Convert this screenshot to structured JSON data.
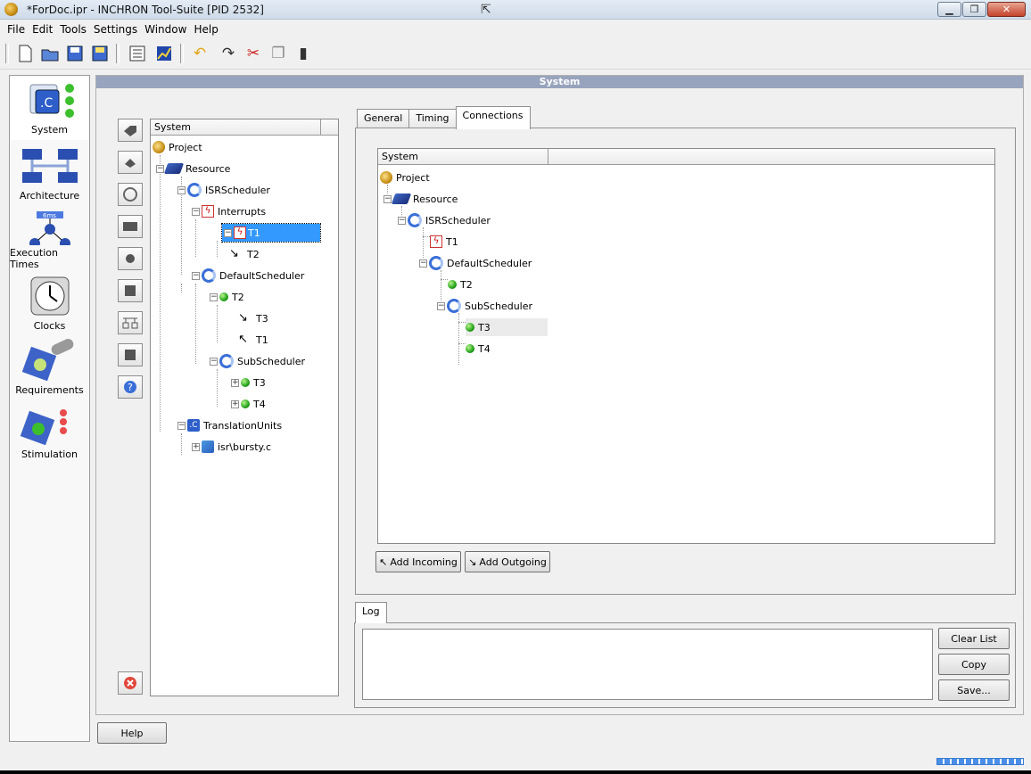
{
  "window": {
    "title": "*ForDoc.ipr - INCHRON Tool-Suite [PID 2532]",
    "minimize": "▁",
    "maximize": "❐",
    "close": "✕"
  },
  "menu": [
    "File",
    "Edit",
    "Tools",
    "Settings",
    "Window",
    "Help"
  ],
  "toolbar": {
    "icons": [
      "new-document-icon",
      "open-folder-icon",
      "save-icon",
      "save-all-icon",
      "properties-icon",
      "chart-icon",
      "undo-icon",
      "redo-icon",
      "cut-icon",
      "copy-icon",
      "paste-icon"
    ]
  },
  "nav": [
    {
      "label": "System",
      "icon": "system-icon",
      "active": true
    },
    {
      "label": "Architecture",
      "icon": "architecture-icon"
    },
    {
      "label": "Execution Times",
      "icon": "execution-times-icon"
    },
    {
      "label": "Clocks",
      "icon": "clock-icon"
    },
    {
      "label": "Requirements",
      "icon": "requirements-icon"
    },
    {
      "label": "Stimulation",
      "icon": "stimulation-icon"
    }
  ],
  "main": {
    "header": "System"
  },
  "left_tree": {
    "column": "System",
    "nodes": {
      "project": "Project",
      "resource": "Resource",
      "isr": "ISRScheduler",
      "interrupts": "Interrupts",
      "t1": "T1",
      "t2a": "T2",
      "default": "DefaultScheduler",
      "t2": "T2",
      "t3a": "T3",
      "t1b": "T1",
      "sub": "SubScheduler",
      "t3": "T3",
      "t4": "T4",
      "tu": "TranslationUnits",
      "file": "isr\\bursty.c"
    }
  },
  "tabs": {
    "general": "General",
    "timing": "Timing",
    "connections": "Connections"
  },
  "conn_tree": {
    "column": "System",
    "nodes": {
      "project": "Project",
      "resource": "Resource",
      "isr": "ISRScheduler",
      "t1": "T1",
      "default": "DefaultScheduler",
      "t2": "T2",
      "sub": "SubScheduler",
      "t3": "T3",
      "t4": "T4"
    }
  },
  "buttons": {
    "add_incoming": "Add Incoming",
    "add_outgoing": "Add Outgoing",
    "clear_list": "Clear List",
    "copy": "Copy",
    "save": "Save...",
    "help": "Help"
  },
  "log": {
    "tab": "Log"
  }
}
